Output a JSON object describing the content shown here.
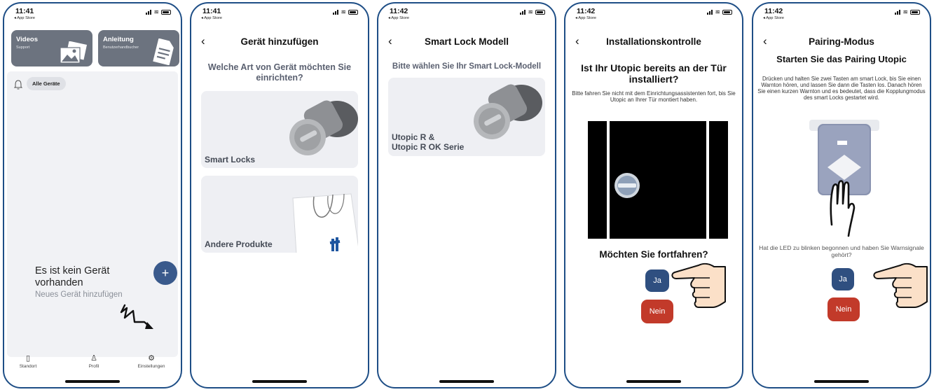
{
  "status": {
    "phone1_time": "11:41",
    "phone2_time": "11:41",
    "phone3_time": "11:42",
    "phone4_time": "11:42",
    "phone5_time": "11:42",
    "back_to": "◂ App Store"
  },
  "screen1": {
    "videos_title": "Videos",
    "videos_sub": "Support",
    "manual_title": "Anleitung",
    "manual_sub": "Benutzerhandbucher",
    "filter_chip": "Alle Geräte",
    "empty_title": "Es ist kein Gerät vorhanden",
    "empty_sub": "Neues Gerät hinzufügen",
    "fab": "+",
    "tabs": [
      {
        "label": "Standort",
        "icon": "bookmark-icon"
      },
      {
        "label": "Profil",
        "icon": "person-icon"
      },
      {
        "label": "Einstellungen",
        "icon": "gear-icon"
      }
    ]
  },
  "screen2": {
    "title": "Gerät hinzufügen",
    "question": "Welche Art von Gerät möchten Sie einrichten?",
    "options": [
      {
        "label": "Smart Locks"
      },
      {
        "label": "Andere Produkte"
      }
    ]
  },
  "screen3": {
    "title": "Smart Lock Modell",
    "prompt": "Bitte wählen Sie Ihr Smart Lock-Modell",
    "model_line1": "Utopic R &",
    "model_line2": "Utopic R OK Serie"
  },
  "screen4": {
    "title": "Installationskontrolle",
    "question": "Ist Ihr Utopic bereits an der Tür installiert?",
    "hint": "Bitte fahren Sie nicht mit dem Einrichtungsassistenten fort, bis Sie Utopic an Ihrer Tür montiert haben.",
    "continue_q": "Möchten Sie fortfahren?",
    "yes": "Ja",
    "no": "Nein"
  },
  "screen5": {
    "title": "Pairing-Modus",
    "heading": "Starten Sie das Pairing Utopic",
    "instructions": "Drücken und halten Sie zwei Tasten am smart Lock, bis Sie einen Warnton hören, und lassen Sie dann die Tasten los. Danach hören Sie einen kurzen Warnton und es bedeutet, dass die Kopplungmodus des smart Locks gestartet wird.",
    "led_q": "Hat die LED zu blinken begonnen und haben Sie Warnsignale gehört?",
    "yes": "Ja",
    "no": "Nein"
  },
  "colors": {
    "accent": "#2f4f80",
    "danger": "#c23a2a",
    "card": "#6c737f",
    "frame": "#1e4e86"
  }
}
